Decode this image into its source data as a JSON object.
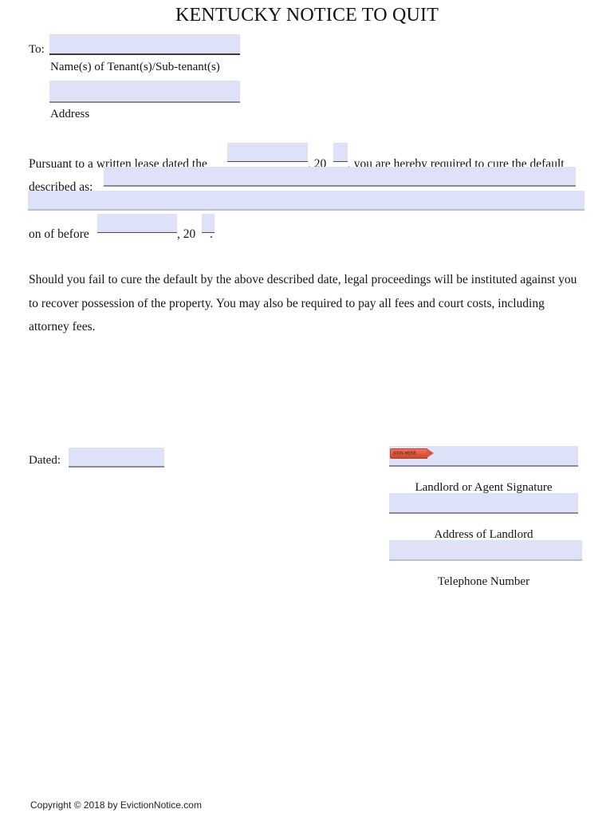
{
  "document": {
    "title": "KENTUCKY NOTICE TO QUIT"
  },
  "recipient": {
    "to_label": "To:",
    "name_field_value": "",
    "name_caption": "Name(s) of Tenant(s)/Sub-tenant(s)",
    "address_field_value": "",
    "address_caption": "Address"
  },
  "lease_clause": {
    "lead_text": "Pursuant to a written lease dated the",
    "date_blank_value": "",
    "year_prefix": ", 20",
    "year_blank_value": "",
    "tail_text": ", you are hereby required to cure the default",
    "described_label": "described as:",
    "described_line1_value": "",
    "described_line2_value": ""
  },
  "deadline_clause": {
    "lead_text": "on of before",
    "date_blank_value": "",
    "year_prefix": ", 20",
    "year_blank_value": "",
    "period": "."
  },
  "warning_paragraph": {
    "text": "Should you fail to cure the default by the above described date, legal proceedings will be instituted against you to recover possession of the property. You may also be required to pay all fees and court costs, including attorney fees."
  },
  "dated_block": {
    "label": "Dated:",
    "value": ""
  },
  "signature_block": {
    "sign_tag_text": "SIGN HERE",
    "signature_value": "",
    "signature_caption": "Landlord or Agent Signature",
    "address_value": "",
    "address_caption": "Address of Landlord",
    "telephone_value": "",
    "telephone_caption": "Telephone Number"
  },
  "footer": {
    "copyright": "Copyright © 2018 by EvictionNotice.com"
  },
  "colors": {
    "field_fill": "#dde2f8",
    "dark_rule": "#3a3a3a",
    "mid_rule": "#8a8a92",
    "soft_rule": "#b9bfd6",
    "sign_tag": "#dd5336",
    "text": "#141414",
    "page_background": "#ffffff"
  }
}
